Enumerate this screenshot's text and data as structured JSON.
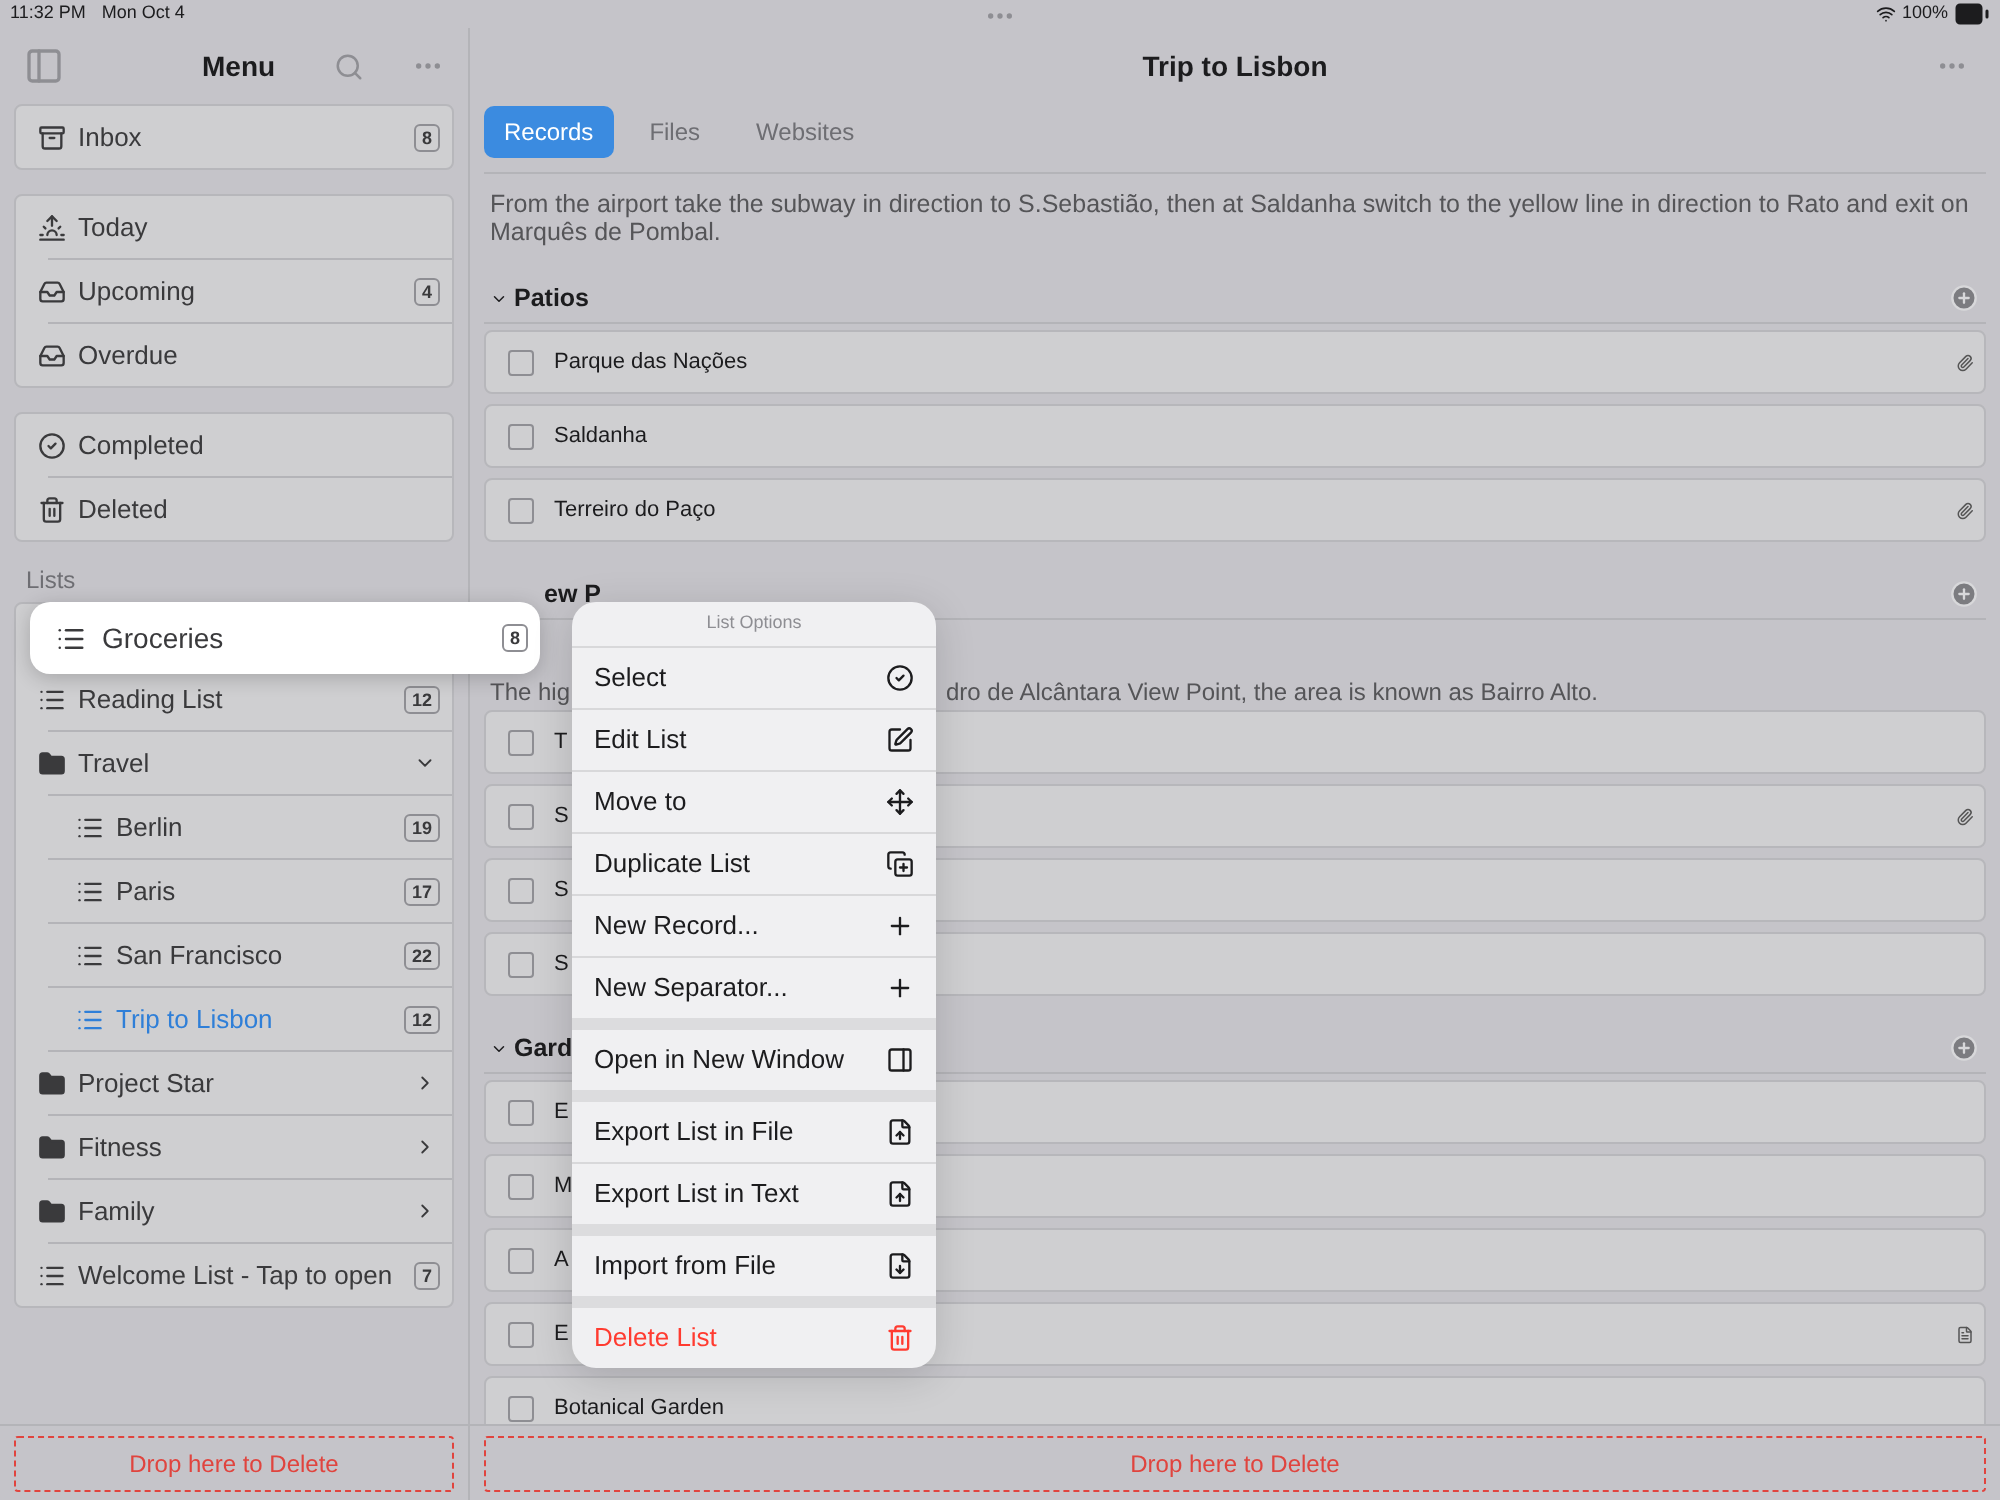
{
  "status_bar": {
    "time": "11:32 PM",
    "date": "Mon Oct 4",
    "battery": "100%"
  },
  "sidebar": {
    "title": "Menu",
    "groups": [
      [
        {
          "label": "Inbox",
          "count": "8",
          "selected": false
        }
      ],
      [
        {
          "label": "Today",
          "selected": false
        },
        {
          "label": "Upcoming",
          "count": "4",
          "selected": false
        },
        {
          "label": "Overdue",
          "selected": false
        }
      ],
      [
        {
          "label": "Completed",
          "selected": false
        },
        {
          "label": "Deleted",
          "selected": false
        }
      ]
    ],
    "lists_label": "Lists",
    "lists": [
      {
        "kind": "list",
        "label": "Groceries",
        "count": "8",
        "selected": false,
        "dragging": true
      },
      {
        "kind": "list",
        "label": "Reading List",
        "count": "12",
        "selected": false,
        "dragging": false
      },
      {
        "kind": "folder",
        "label": "Travel",
        "selected": false,
        "expanded": true,
        "children": [
          {
            "kind": "list",
            "label": "Berlin",
            "count": "19",
            "selected": false,
            "dragging": false
          },
          {
            "kind": "list",
            "label": "Paris",
            "count": "17",
            "selected": false,
            "dragging": false
          },
          {
            "kind": "list",
            "label": "San Francisco",
            "count": "22",
            "selected": false,
            "dragging": false
          },
          {
            "kind": "list",
            "label": "Trip to Lisbon",
            "count": "12",
            "selected": true,
            "dragging": false
          }
        ]
      },
      {
        "kind": "folder",
        "label": "Project Star",
        "selected": false,
        "expanded": false
      },
      {
        "kind": "folder",
        "label": "Fitness",
        "selected": false,
        "expanded": false
      },
      {
        "kind": "folder",
        "label": "Family",
        "selected": false,
        "expanded": false
      },
      {
        "kind": "list",
        "label": "Welcome List - Tap to open",
        "count": "7",
        "selected": false,
        "dragging": false
      }
    ],
    "drop_zone": "Drop here to Delete"
  },
  "main": {
    "title": "Trip to Lisbon",
    "tabs": [
      {
        "label": "Records",
        "selected": true
      },
      {
        "label": "Files",
        "selected": false
      },
      {
        "label": "Websites",
        "selected": false
      }
    ],
    "note": "From the airport take the subway in direction to S.Sebastião, then at Saldanha switch to the yellow line in direction to Rato and exit on Marquês de Pombal.",
    "sections": [
      {
        "title": "Patios",
        "expanded": true,
        "records": [
          {
            "kind": "clip",
            "label": "Parque das Nações",
            "checked": false
          },
          {
            "kind": "plain",
            "label": "Saldanha",
            "checked": false
          },
          {
            "kind": "clip",
            "label": "Terreiro do Paço",
            "checked": false
          }
        ]
      },
      {
        "title": "ew P",
        "note_parts": [
          "The hig",
          "dro de Alcântara View Point, the area is known as Bairro Alto."
        ],
        "records": [
          {
            "kind": "plain",
            "label": "T",
            "checked": false
          },
          {
            "kind": "clip",
            "label": "S",
            "checked": false
          },
          {
            "kind": "plain",
            "label": "S",
            "checked": false
          },
          {
            "kind": "plain",
            "label": "S",
            "checked": false
          }
        ]
      },
      {
        "title": "Gard",
        "expanded": true,
        "records": [
          {
            "kind": "plain",
            "label": "E",
            "checked": false
          },
          {
            "kind": "plain",
            "label": "M",
            "checked": false
          },
          {
            "kind": "plain",
            "label": "A",
            "checked": false
          },
          {
            "kind": "document",
            "label": "E",
            "checked": false
          },
          {
            "kind": "plain",
            "label": "Botanical Garden",
            "checked": false
          }
        ]
      }
    ],
    "drop_zone": "Drop here to Delete"
  },
  "menu": {
    "title": "List Options",
    "groups": [
      [
        {
          "label": "Select",
          "destructive": false
        },
        {
          "label": "Edit List",
          "destructive": false
        },
        {
          "label": "Move to",
          "destructive": false
        },
        {
          "label": "Duplicate List",
          "destructive": false
        },
        {
          "label": "New Record...",
          "destructive": false
        },
        {
          "label": "New Separator...",
          "destructive": false
        }
      ],
      [
        {
          "label": "Open in New Window",
          "destructive": false
        }
      ],
      [
        {
          "label": "Export List in File",
          "destructive": false
        },
        {
          "label": "Export List in Text",
          "destructive": false
        }
      ],
      [
        {
          "label": "Import from File",
          "destructive": false
        }
      ],
      [
        {
          "label": "Delete List",
          "destructive": true
        }
      ]
    ]
  }
}
